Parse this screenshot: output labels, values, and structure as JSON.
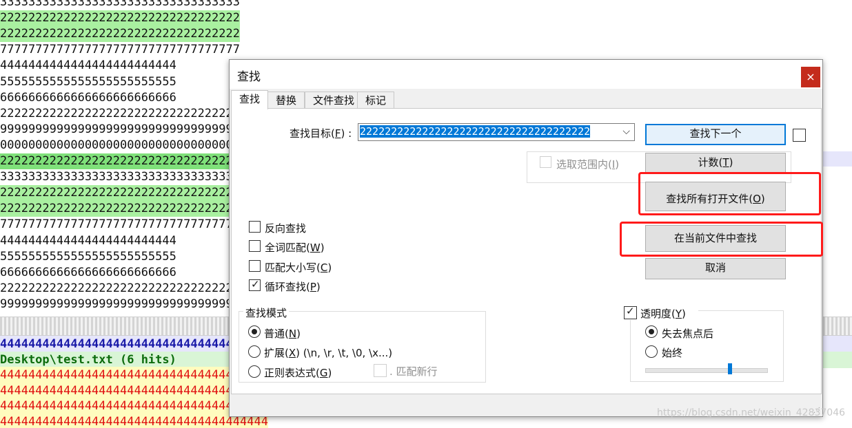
{
  "editor": {
    "lines": [
      {
        "text": "3333333333333333333333333333333333",
        "hl": ""
      },
      {
        "text": "2222222222222222222222222222222222",
        "hl": "green"
      },
      {
        "text": "2222222222222222222222222222222222",
        "hl": "green"
      },
      {
        "text": "7777777777777777777777777777777777",
        "hl": ""
      },
      {
        "text": "4444444444444444444444444",
        "hl": ""
      },
      {
        "text": "5555555555555555555555555",
        "hl": ""
      },
      {
        "text": "6666666666666666666666666",
        "hl": ""
      },
      {
        "text": "2222222222222222222222222222222222",
        "hl": ""
      },
      {
        "text": "9999999999999999999999999999999999",
        "hl": ""
      },
      {
        "text": "0000000000000000000000000000000000",
        "hl": ""
      },
      {
        "text": "2222222222222222222222222222222222",
        "hl": "dark"
      },
      {
        "text": "3333333333333333333333333333333333",
        "hl": ""
      },
      {
        "text": "2222222222222222222222222222222222",
        "hl": "green"
      },
      {
        "text": "2222222222222222222222222222222222",
        "hl": "green"
      },
      {
        "text": "7777777777777777777777777777777777",
        "hl": ""
      },
      {
        "text": "4444444444444444444444444",
        "hl": ""
      },
      {
        "text": "5555555555555555555555555",
        "hl": ""
      },
      {
        "text": "6666666666666666666666666",
        "hl": ""
      },
      {
        "text": "2222222222222222222222222222222222",
        "hl": ""
      },
      {
        "text": "9999999999999999999999999999999999",
        "hl": ""
      }
    ]
  },
  "results": {
    "lines": [
      {
        "text": "44444444444444444444444444444444444444",
        "style": "blue"
      },
      {
        "text": "Desktop\\test.txt (6 hits)",
        "style": "green"
      },
      {
        "text": "44444444444444444444444444444444444444",
        "style": "red"
      },
      {
        "text": "44444444444444444444444444444444444444",
        "style": "red"
      },
      {
        "text": "44444444444444444444444444444444444444",
        "style": "red"
      },
      {
        "text": "44444444444444444444444444444444444444",
        "style": "red"
      }
    ]
  },
  "dialog": {
    "title": "查找",
    "close_glyph": "×",
    "tabs": [
      {
        "label": "查找",
        "active": true
      },
      {
        "label": "替换",
        "active": false
      },
      {
        "label": "文件查找",
        "active": false
      },
      {
        "label": "标记",
        "active": false
      }
    ],
    "find_target_label": "查找目标(",
    "find_target_key": "F",
    "find_target_suffix": ") :",
    "find_value": "2222222222222222222222222222222222222",
    "combo_arrow": "⌵",
    "in_selection_label": "选取范围内(",
    "in_selection_key": "I",
    "in_selection_suffix": ")",
    "options": {
      "backward": {
        "label": "反向查找",
        "checked": false
      },
      "whole_word": {
        "label": "全词匹配(",
        "key": "W",
        "suffix": ")",
        "checked": false
      },
      "match_case": {
        "label": "匹配大小写(",
        "key": "C",
        "suffix": ")",
        "checked": false
      },
      "wrap": {
        "label": "循环查找(",
        "key": "P",
        "suffix": ")",
        "checked": true
      }
    },
    "buttons": {
      "find_next": "查找下一个",
      "count_prefix": "计数(",
      "count_key": "T",
      "count_suffix": ")",
      "find_all_open_prefix": "查找所有打开文件(",
      "find_all_open_key": "O",
      "find_all_open_suffix": ")",
      "find_all_current": "在当前文件中查找",
      "cancel": "取消"
    },
    "search_mode": {
      "title": "查找模式",
      "normal": {
        "label": "普通(",
        "key": "N",
        "suffix": ")",
        "selected": true
      },
      "extended": {
        "label": "扩展(",
        "key": "X",
        "suffix": ") (\\n, \\r, \\t, \\0, \\x...)",
        "selected": false
      },
      "regex": {
        "label": "正则表达式(",
        "key": "G",
        "suffix": ")",
        "selected": false
      },
      "dot_newline": {
        "label": ". 匹配新行",
        "checked": false
      }
    },
    "transparency": {
      "label": "透明度(",
      "key": "Y",
      "suffix": ")",
      "checked": true,
      "on_lose_focus": {
        "label": "失去焦点后",
        "selected": true
      },
      "always": {
        "label": "始终",
        "selected": false
      },
      "level": 0.7
    }
  },
  "watermark": "https://blog.csdn.net/weixin_42837046"
}
